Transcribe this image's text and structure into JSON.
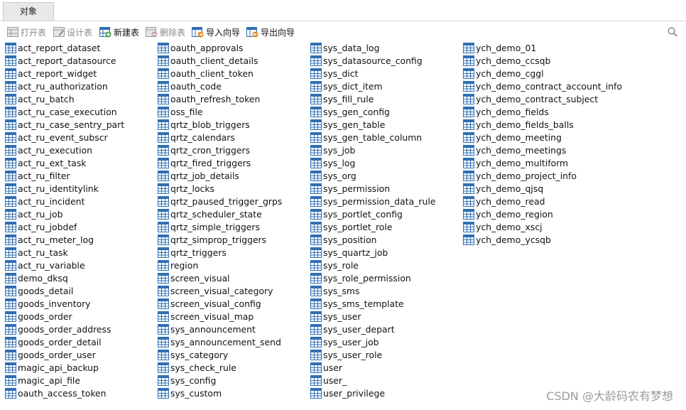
{
  "tab": {
    "label": "对象"
  },
  "toolbar": {
    "open_table": "打开表",
    "design_table": "设计表",
    "new_table": "新建表",
    "delete_table": "删除表",
    "import_wizard": "导入向导",
    "export_wizard": "导出向导"
  },
  "tables": [
    [
      "act_report_dataset",
      "act_report_datasource",
      "act_report_widget",
      "act_ru_authorization",
      "act_ru_batch",
      "act_ru_case_execution",
      "act_ru_case_sentry_part",
      "act_ru_event_subscr",
      "act_ru_execution",
      "act_ru_ext_task",
      "act_ru_filter",
      "act_ru_identitylink",
      "act_ru_incident",
      "act_ru_job",
      "act_ru_jobdef",
      "act_ru_meter_log",
      "act_ru_task",
      "act_ru_variable",
      "demo_dksq",
      "goods_detail",
      "goods_inventory",
      "goods_order",
      "goods_order_address",
      "goods_order_detail",
      "goods_order_user",
      "magic_api_backup",
      "magic_api_file",
      "oauth_access_token"
    ],
    [
      "oauth_approvals",
      "oauth_client_details",
      "oauth_client_token",
      "oauth_code",
      "oauth_refresh_token",
      "oss_file",
      "qrtz_blob_triggers",
      "qrtz_calendars",
      "qrtz_cron_triggers",
      "qrtz_fired_triggers",
      "qrtz_job_details",
      "qrtz_locks",
      "qrtz_paused_trigger_grps",
      "qrtz_scheduler_state",
      "qrtz_simple_triggers",
      "qrtz_simprop_triggers",
      "qrtz_triggers",
      "region",
      "screen_visual",
      "screen_visual_category",
      "screen_visual_config",
      "screen_visual_map",
      "sys_announcement",
      "sys_announcement_send",
      "sys_category",
      "sys_check_rule",
      "sys_config",
      "sys_custom"
    ],
    [
      "sys_data_log",
      "sys_datasource_config",
      "sys_dict",
      "sys_dict_item",
      "sys_fill_rule",
      "sys_gen_config",
      "sys_gen_table",
      "sys_gen_table_column",
      "sys_job",
      "sys_log",
      "sys_org",
      "sys_permission",
      "sys_permission_data_rule",
      "sys_portlet_config",
      "sys_portlet_role",
      "sys_position",
      "sys_quartz_job",
      "sys_role",
      "sys_role_permission",
      "sys_sms",
      "sys_sms_template",
      "sys_user",
      "sys_user_depart",
      "sys_user_job",
      "sys_user_role",
      "user",
      "user_",
      "user_privilege"
    ],
    [
      "ych_demo_01",
      "ych_demo_ccsqb",
      "ych_demo_cggl",
      "ych_demo_contract_account_info",
      "ych_demo_contract_subject",
      "ych_demo_fields",
      "ych_demo_fields_balls",
      "ych_demo_meeting",
      "ych_demo_meetings",
      "ych_demo_multiform",
      "ych_demo_project_info",
      "ych_demo_qjsq",
      "ych_demo_read",
      "ych_demo_region",
      "ych_demo_xscj",
      "ych_demo_ycsqb"
    ]
  ],
  "watermark": "CSDN @大龄码农有梦想",
  "icons": {
    "table": "table-icon",
    "open": "open-table-icon",
    "design": "design-table-icon",
    "new": "new-table-icon",
    "delete": "delete-table-icon",
    "import": "import-wizard-icon",
    "export": "export-wizard-icon",
    "search": "search-icon"
  },
  "colors": {
    "table_icon": "#2f6fb3",
    "disabled_text": "#8a8a8a"
  }
}
